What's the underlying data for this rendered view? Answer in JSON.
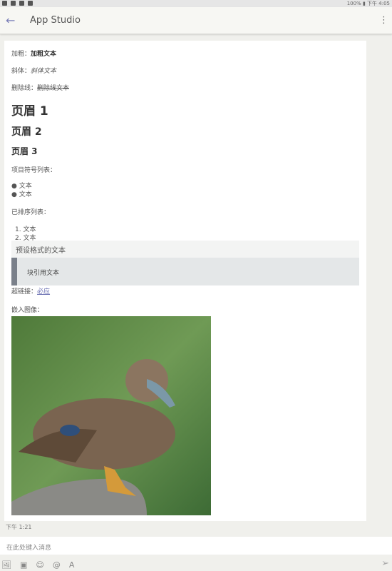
{
  "status": {
    "time": "下午 4:05",
    "battery": "100%"
  },
  "appbar": {
    "title": "App Studio"
  },
  "message": {
    "bold_label": "加粗：",
    "bold_text": "加粗文本",
    "italic_label": "斜体：",
    "italic_text": "斜体文本",
    "strike_label": "删除线：",
    "strike_text": "删除线文本",
    "h1": "页眉 1",
    "h2": "页眉 2",
    "h3": "页眉 3",
    "bullet_label": "项目符号列表：",
    "bullets": [
      "文本",
      "文本"
    ],
    "ordered_label": "已排序列表：",
    "ordered": [
      "1. 文本",
      "2. 文本"
    ],
    "preformatted": "预设格式的文本",
    "blockquote": "块引用文本",
    "link_label": "超链接：",
    "link_text": "必应",
    "image_label": "嵌入图像：",
    "timestamp": "下午 1:21"
  },
  "compose": {
    "placeholder": "在此处键入消息"
  }
}
